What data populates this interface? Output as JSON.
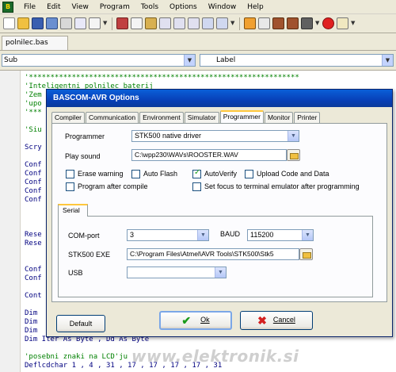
{
  "menu": [
    "File",
    "Edit",
    "View",
    "Program",
    "Tools",
    "Options",
    "Window",
    "Help"
  ],
  "file_tab": "polnilec.bas",
  "sub_combo": "Sub",
  "label_combo": "Label",
  "code_lines": [
    {
      "text": "'***************************************************************",
      "cls": "c-comment"
    },
    {
      "text": "'Inteligentni polnilec baterij",
      "cls": "c-comment"
    },
    {
      "text": "'Zem",
      "cls": "c-comment"
    },
    {
      "text": "'upo",
      "cls": "c-comment"
    },
    {
      "text": "'***",
      "cls": "c-comment"
    },
    {
      "text": "",
      "cls": "c-plain"
    },
    {
      "text": "'Siu",
      "cls": "c-comment"
    },
    {
      "text": "",
      "cls": "c-plain"
    },
    {
      "text": "Scry",
      "cls": "c-kw"
    },
    {
      "text": "",
      "cls": "c-plain"
    },
    {
      "text": "Conf",
      "cls": "c-kw"
    },
    {
      "text": "Conf",
      "cls": "c-kw"
    },
    {
      "text": "Conf",
      "cls": "c-kw"
    },
    {
      "text": "Conf",
      "cls": "c-kw"
    },
    {
      "text": "Conf",
      "cls": "c-kw"
    },
    {
      "text": "",
      "cls": "c-plain"
    },
    {
      "text": "",
      "cls": "c-plain"
    },
    {
      "text": "",
      "cls": "c-plain"
    },
    {
      "text": "Rese",
      "cls": "c-kw"
    },
    {
      "text": "Rese",
      "cls": "c-kw"
    },
    {
      "text": "",
      "cls": "c-plain"
    },
    {
      "text": "",
      "cls": "c-plain"
    },
    {
      "text": "Conf",
      "cls": "c-kw"
    },
    {
      "text": "Conf",
      "cls": "c-kw"
    },
    {
      "text": "",
      "cls": "c-plain"
    },
    {
      "text": "Cont",
      "cls": "c-kw"
    },
    {
      "text": "",
      "cls": "c-plain"
    },
    {
      "text": "Dim",
      "cls": "c-kw"
    },
    {
      "text": "Dim",
      "cls": "c-kw"
    },
    {
      "text": "Dim",
      "cls": "c-kw"
    },
    {
      "text": "Dim Iter As Byte , Dd As Byte",
      "cls": "c-kw"
    },
    {
      "text": "",
      "cls": "c-plain"
    },
    {
      "text": "'posebni znaki na LCD'ju",
      "cls": "c-comment"
    },
    {
      "text": "Deflcdchar 1 , 4 , 31 , 17 , 17 , 17 , 17 , 31",
      "cls": "c-kw"
    }
  ],
  "dialog": {
    "title": "BASCOM-AVR Options",
    "tabs": [
      "Compiler",
      "Communication",
      "Environment",
      "Simulator",
      "Programmer",
      "Monitor",
      "Printer"
    ],
    "active_tab": "Programmer",
    "programmer_label": "Programmer",
    "programmer_value": "STK500 native driver",
    "play_sound_label": "Play sound",
    "play_sound_value": "C:\\wpp230\\WAVs\\ROOSTER.WAV",
    "checkboxes": [
      {
        "label": "Erase warning",
        "checked": false
      },
      {
        "label": "Auto Flash",
        "checked": false
      },
      {
        "label": "AutoVerify",
        "checked": true
      },
      {
        "label": "Upload Code and Data",
        "checked": false
      },
      {
        "label": "Program after compile",
        "checked": false
      },
      {
        "label": "Set focus to terminal emulator after programming",
        "checked": false
      }
    ],
    "serial_tab": "Serial",
    "com_port_label": "COM-port",
    "com_port_value": "3",
    "baud_label": "BAUD",
    "baud_value": "115200",
    "stk500_exe_label": "STK500 EXE",
    "stk500_exe_value": "C:\\Program Files\\Atmel\\AVR Tools\\STK500\\Stk5",
    "usb_label": "USB",
    "usb_value": "",
    "default_button": "Default",
    "ok_button": "Ok",
    "cancel_button": "Cancel"
  },
  "watermark": "www.elektronik.si",
  "colors": {
    "title_bar": "#0a5fd8",
    "comment": "#008000",
    "keyword": "#000080"
  }
}
